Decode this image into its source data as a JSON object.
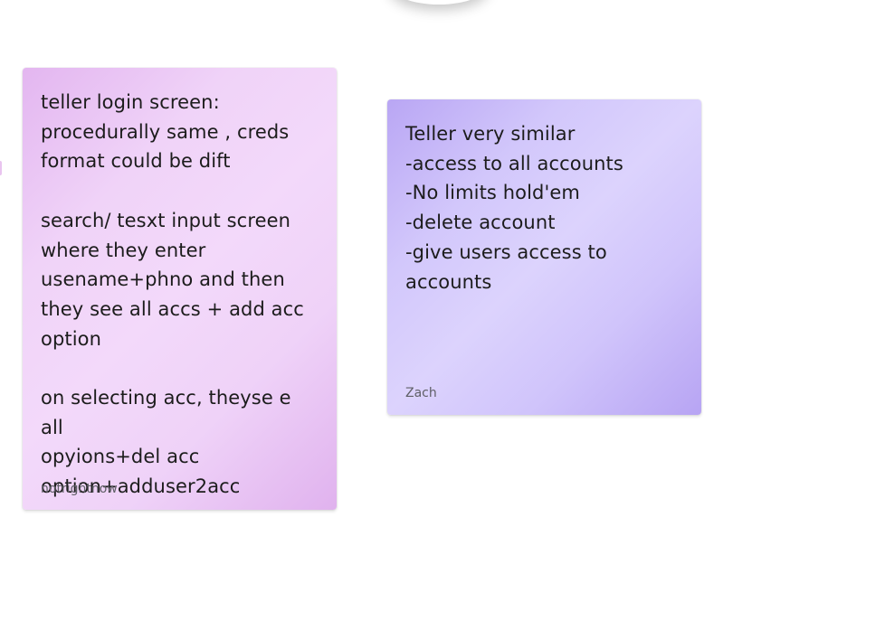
{
  "notes": [
    {
      "text": "teller login screen:\nprocedurally same , creds\nformat could be dift\n\nsearch/ tesxt input screen\nwhere they enter\nusename+phno and then\nthey see all accs + add acc\noption\n\non selecting acc, theyse e all\nopyions+del acc\noption+adduser2acc",
      "author": "notrightnow"
    },
    {
      "text": "Teller very similar\n-access to all accounts\n-No limits hold'em\n-delete account\n-give users access to\naccounts",
      "author": "Zach"
    }
  ],
  "colors": {
    "pink_note": "#f0d3f8",
    "purple_note": "#d2c7fb",
    "author_text": "#5f5f66"
  }
}
